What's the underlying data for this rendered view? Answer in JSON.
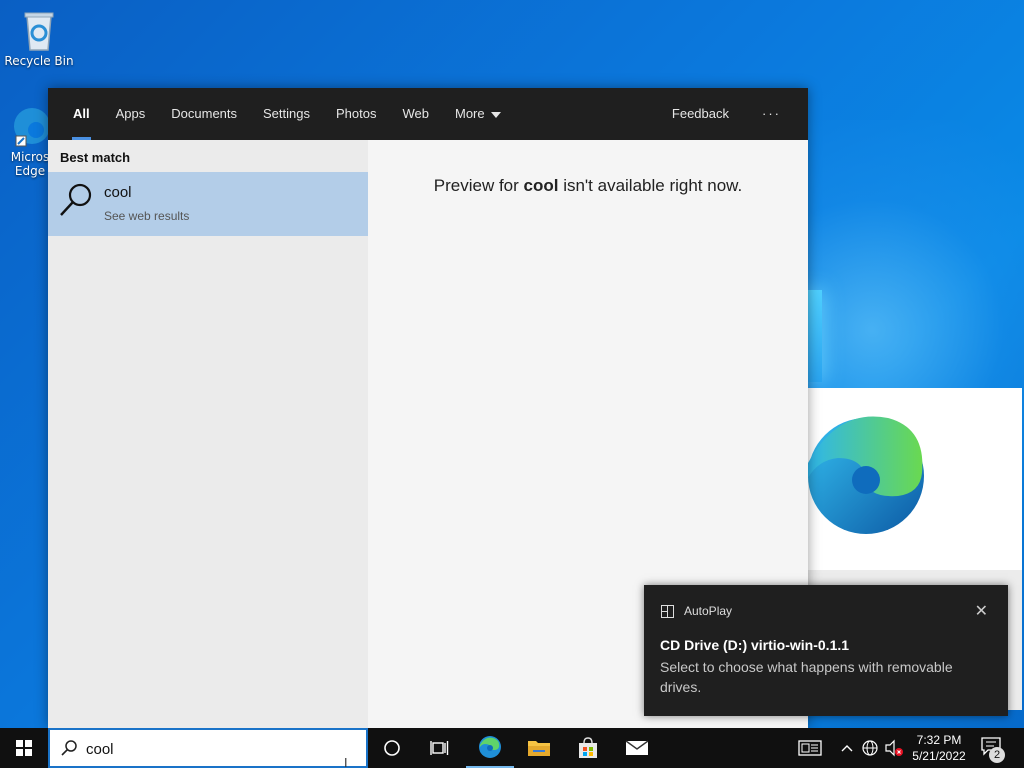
{
  "desktop": {
    "recycle_bin_label": "Recycle Bin",
    "edge_label_line1": "Micros",
    "edge_label_line2": "Edge"
  },
  "search": {
    "tabs": [
      {
        "label": "All",
        "active": true
      },
      {
        "label": "Apps"
      },
      {
        "label": "Documents"
      },
      {
        "label": "Settings"
      },
      {
        "label": "Photos"
      },
      {
        "label": "Web"
      },
      {
        "label": "More"
      }
    ],
    "feedback_label": "Feedback",
    "more_options_label": "···",
    "best_match_label": "Best match",
    "result": {
      "title": "cool",
      "subtitle": "See web results"
    },
    "preview": {
      "prefix": "Preview for ",
      "term": "cool",
      "suffix": " isn't available right now."
    },
    "query": "cool"
  },
  "toast": {
    "app": "AutoPlay",
    "close": "✕",
    "title": "CD Drive (D:) virtio-win-0.1.1",
    "body": "Select to choose what happens with removable drives."
  },
  "taskbar": {
    "time": "7:32 PM",
    "date": "5/21/2022",
    "notification_count": "2"
  },
  "colors": {
    "accent": "#1a73c8",
    "selection": "#b3cde8",
    "dark_ui": "#1f1f1f"
  }
}
